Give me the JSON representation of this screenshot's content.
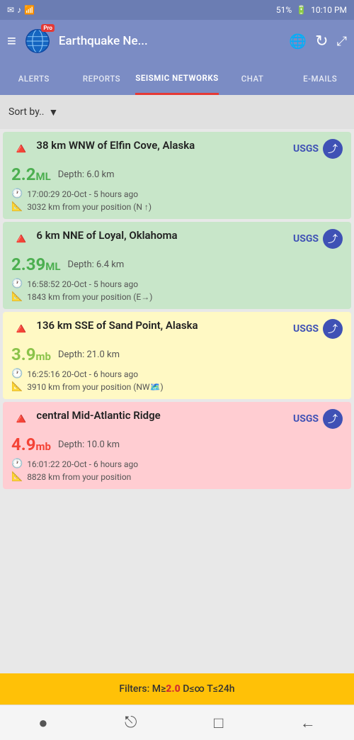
{
  "statusBar": {
    "leftIcons": [
      "✉",
      "🎵",
      "📶"
    ],
    "signal": "51%",
    "battery": "🔋",
    "time": "10:10 PM"
  },
  "header": {
    "title": "Earthquake Ne...",
    "proBadge": "Pro",
    "menuIcon": "≡",
    "globeIcon": "🌐",
    "refreshIcon": "↻",
    "expandIcon": "⤢"
  },
  "tabs": [
    {
      "id": "alerts",
      "label": "ALERTS"
    },
    {
      "id": "reports",
      "label": "REPORTS"
    },
    {
      "id": "seismic",
      "label": "SEISMIC NETWORKS",
      "active": true
    },
    {
      "id": "chat",
      "label": "CHAT"
    },
    {
      "id": "emails",
      "label": "E-MAILS"
    }
  ],
  "earthquakes": [
    {
      "id": "eq1",
      "location": "38 km WNW of Elfin Cove, Alaska",
      "source": "USGS",
      "magnitude": "2.2",
      "magnitudeType": "ML",
      "magnitudeClass": "green",
      "depth": "6.0 km",
      "time": "17:00:29 20-Oct - 5 hours ago",
      "distance": "3032 km from your position (N ↑)",
      "cardClass": "",
      "icon": "🔺"
    },
    {
      "id": "eq2",
      "location": "6 km NNE of Loyal, Oklahoma",
      "source": "USGS",
      "magnitude": "2.39",
      "magnitudeType": "ML",
      "magnitudeClass": "green",
      "depth": "6.4 km",
      "time": "16:58:52 20-Oct - 5 hours ago",
      "distance": "1843 km from your position (E→)",
      "cardClass": "",
      "icon": "🔺"
    },
    {
      "id": "eq3",
      "location": "136 km SSE of Sand Point, Alaska",
      "source": "USGS",
      "magnitude": "3.9",
      "magnitudeType": "mb",
      "magnitudeClass": "olive",
      "depth": "21.0 km",
      "time": "16:25:16 20-Oct - 6 hours ago",
      "distance": "3910 km from your position (NW🗺️)",
      "cardClass": "yellow",
      "icon": "🔺"
    },
    {
      "id": "eq4",
      "location": "central Mid-Atlantic Ridge",
      "source": "USGS",
      "magnitude": "4.9",
      "magnitudeType": "mb",
      "magnitudeClass": "red-text",
      "depth": "10.0 km",
      "time": "16:01:22 20-Oct - 6 hours ago",
      "distance": "8828 km from your position",
      "cardClass": "red",
      "icon": "🔺"
    }
  ],
  "sortBar": {
    "label": "Sort by..",
    "dropdownIcon": "▼"
  },
  "filterBar": {
    "prefix": "Filters: M≥",
    "magnitudeValue": "2.0",
    "suffix": " D≤∞ T≤24h"
  },
  "bottomNav": {
    "icons": [
      "●",
      "⎋",
      "□",
      "←"
    ]
  }
}
